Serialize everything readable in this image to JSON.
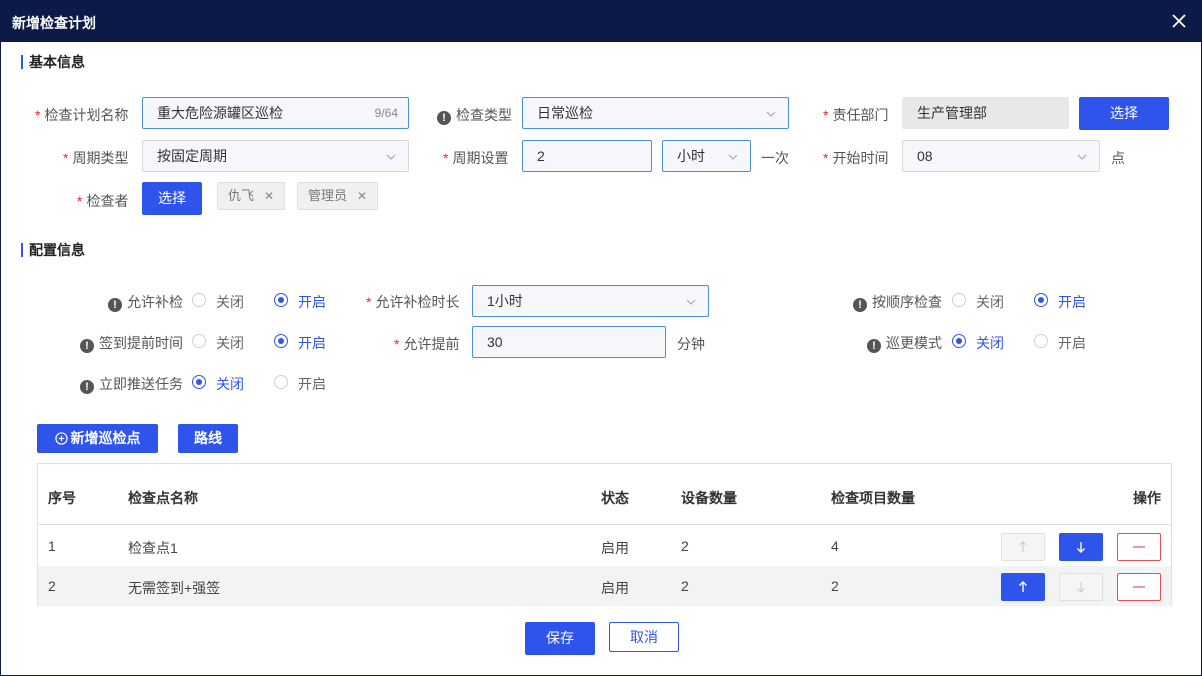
{
  "dialog": {
    "title": "新增检查计划"
  },
  "basic": {
    "section_title": "基本信息",
    "plan_name": {
      "label": "检查计划名称",
      "value": "重大危险源罐区巡检",
      "counter": "9/64"
    },
    "check_type": {
      "label": "检查类型",
      "value": "日常巡检"
    },
    "dept": {
      "label": "责任部门",
      "value": "生产管理部",
      "button": "选择"
    },
    "cycle_type": {
      "label": "周期类型",
      "value": "按固定周期"
    },
    "cycle_setting": {
      "label": "周期设置",
      "value": "2",
      "unit_value": "小时",
      "suffix": "一次"
    },
    "start_time": {
      "label": "开始时间",
      "value": "08",
      "suffix": "点"
    },
    "inspector": {
      "label": "检查者",
      "button": "选择",
      "tags": [
        "仇飞",
        "管理员"
      ]
    }
  },
  "config": {
    "section_title": "配置信息",
    "allow_makeup": {
      "label": "允许补检",
      "off": "关闭",
      "on": "开启",
      "selected": "on"
    },
    "makeup_duration": {
      "label": "允许补检时长",
      "value": "1小时"
    },
    "sequential": {
      "label": "按顺序检查",
      "off": "关闭",
      "on": "开启",
      "selected": "on"
    },
    "checkin_advance": {
      "label": "签到提前时间",
      "off": "关闭",
      "on": "开启",
      "selected": "on"
    },
    "allow_advance": {
      "label": "允许提前",
      "value": "30",
      "unit": "分钟"
    },
    "patrol_mode": {
      "label": "巡更模式",
      "off": "关闭",
      "on": "开启",
      "selected": "off"
    },
    "push_now": {
      "label": "立即推送任务",
      "off": "关闭",
      "on": "开启",
      "selected": "off"
    }
  },
  "toolbar": {
    "add_point": "新增巡检点",
    "route": "路线"
  },
  "table": {
    "headers": {
      "index": "序号",
      "name": "检查点名称",
      "status": "状态",
      "devices": "设备数量",
      "items": "检查项目数量",
      "ops": "操作"
    },
    "rows": [
      {
        "index": "1",
        "name": "检查点1",
        "status": "启用",
        "devices": "2",
        "items": "4"
      },
      {
        "index": "2",
        "name": "无需签到+强签",
        "status": "启用",
        "devices": "2",
        "items": "2"
      }
    ]
  },
  "footer": {
    "save": "保存",
    "cancel": "取消"
  },
  "colors": {
    "primary": "#2f54eb",
    "header_bg": "#0b1a47",
    "required": "#f5222d",
    "delete": "#e05050"
  }
}
